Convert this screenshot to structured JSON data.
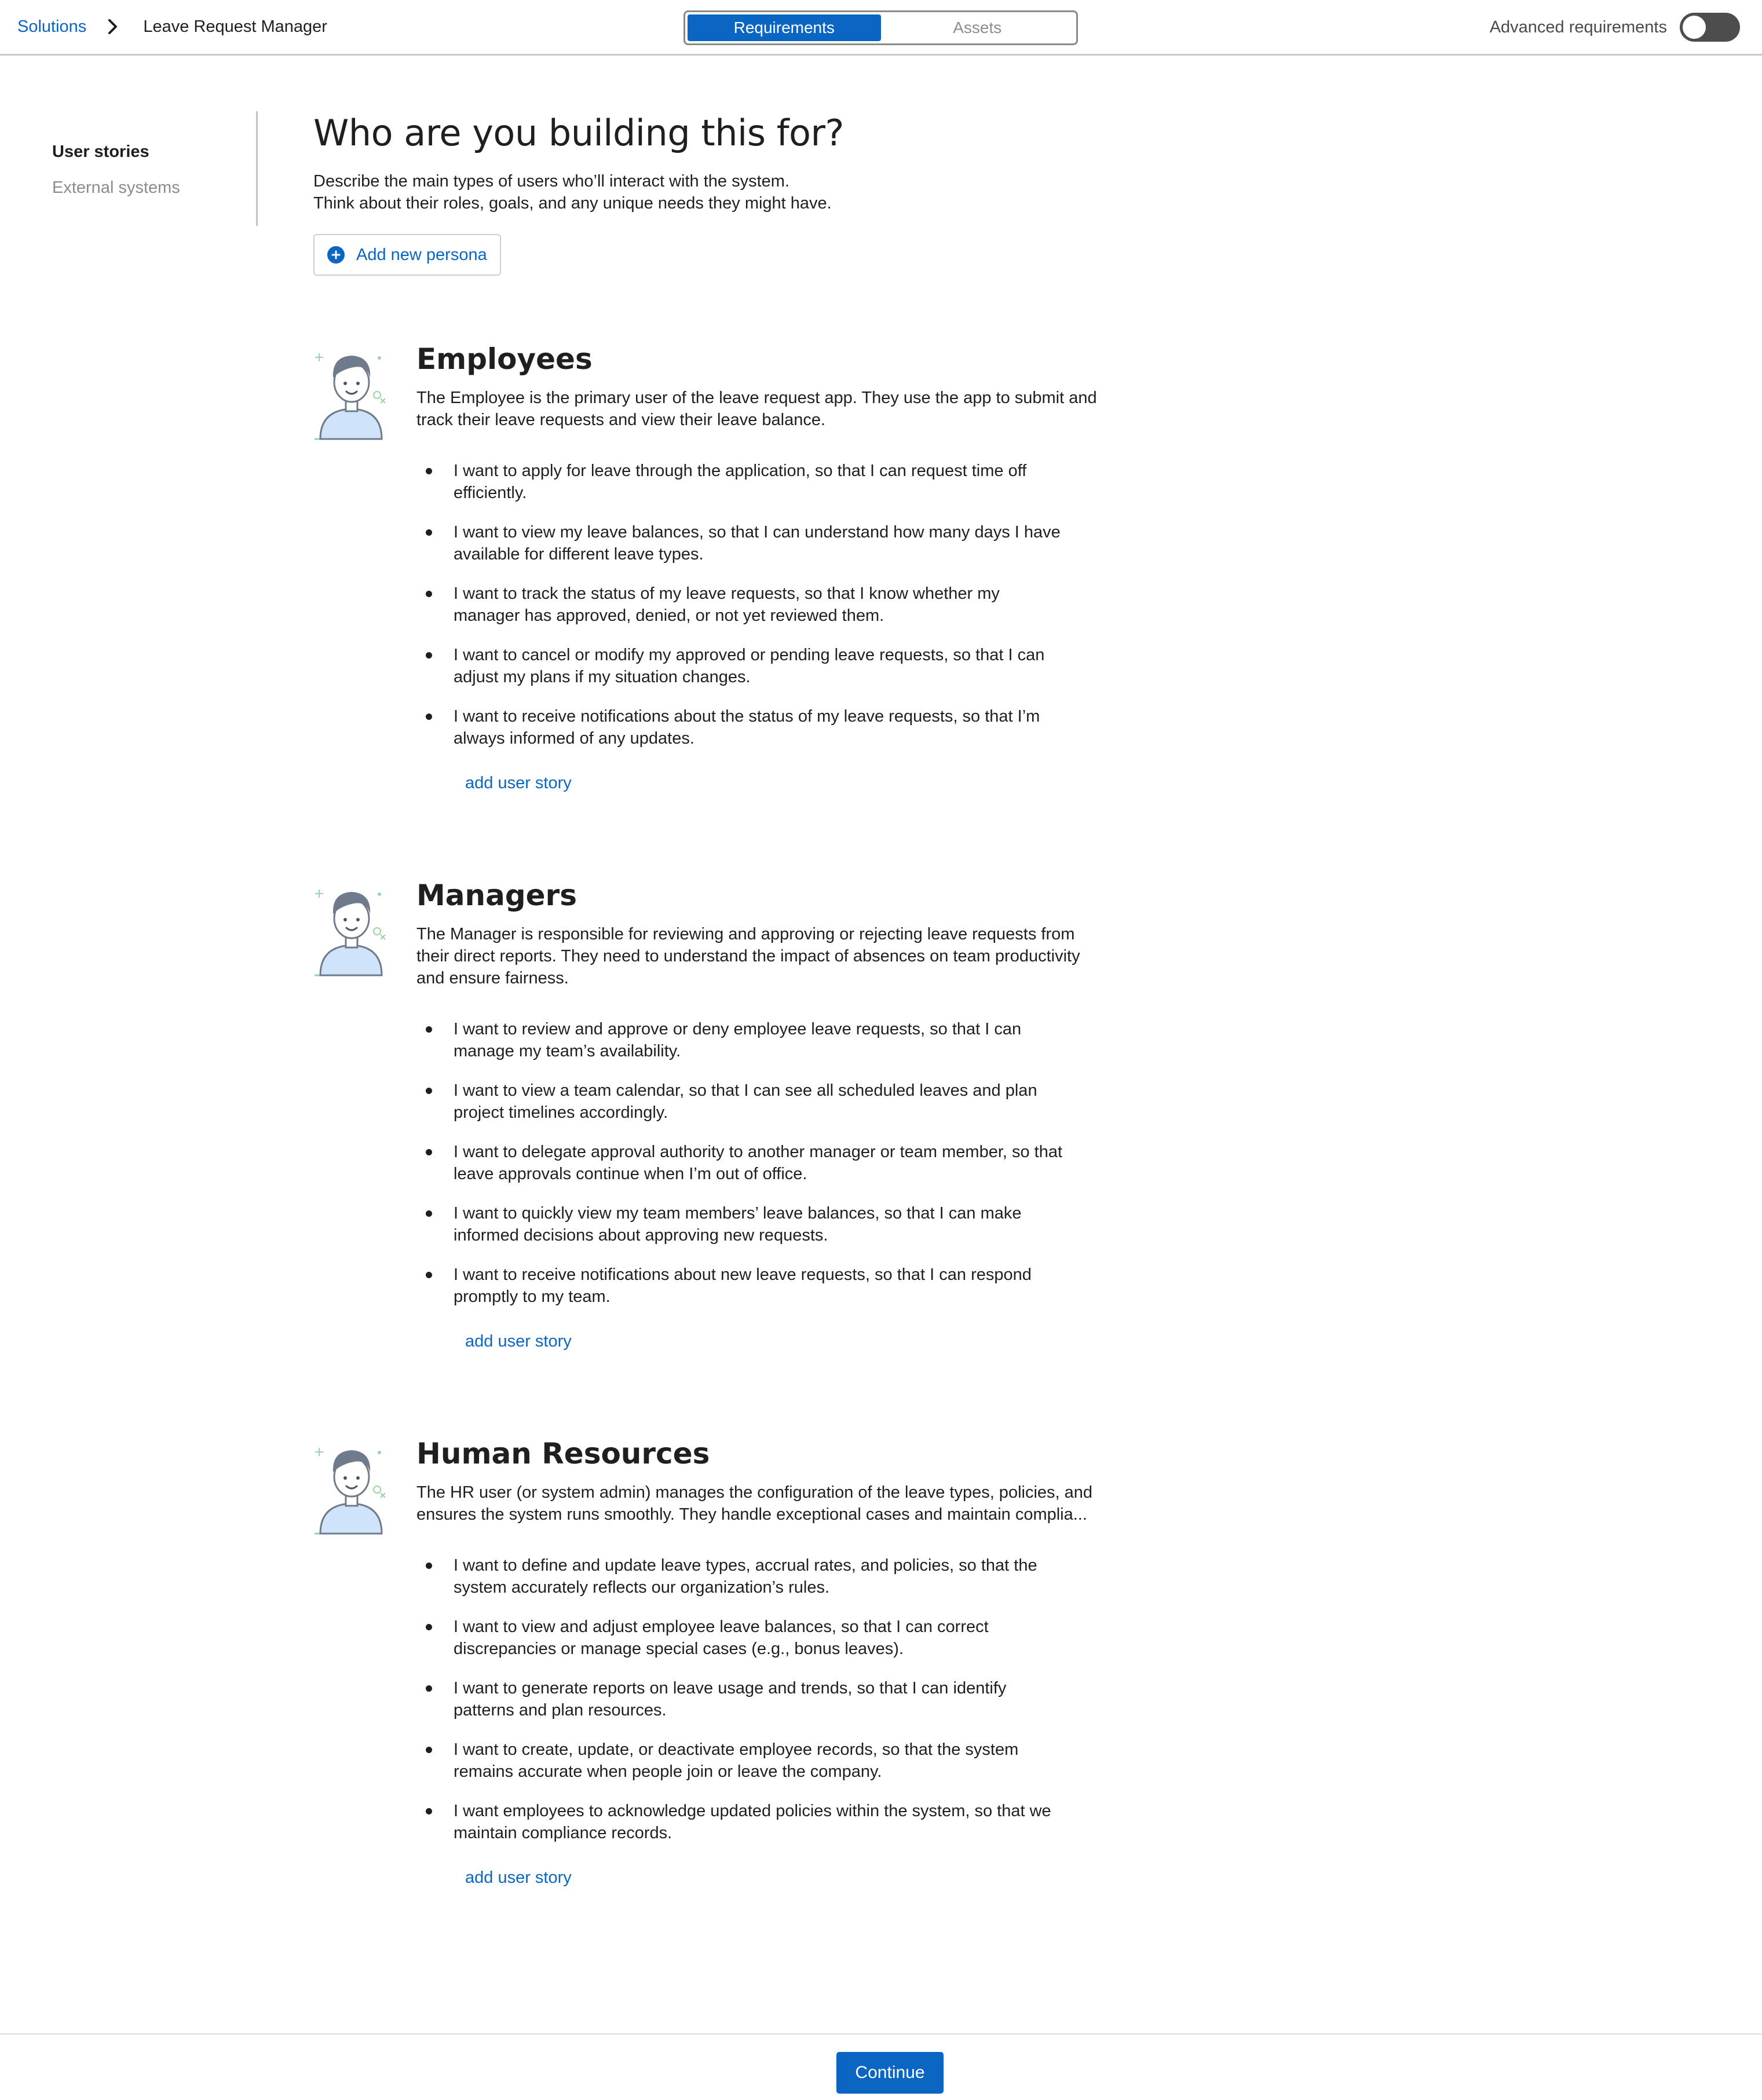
{
  "breadcrumb": {
    "root": "Solutions",
    "current": "Leave Request Manager"
  },
  "tabs": [
    {
      "label": "Requirements",
      "active": true
    },
    {
      "label": "Assets",
      "active": false
    }
  ],
  "advanced": {
    "label": "Advanced requirements",
    "enabled": false
  },
  "sidebar": {
    "items": [
      {
        "label": "User stories",
        "active": true
      },
      {
        "label": "External systems",
        "active": false
      }
    ]
  },
  "main": {
    "title": "Who are you building this for?",
    "desc_line1": "Describe the main types of users who’ll interact with the system.",
    "desc_line2": "Think about their roles, goals, and any unique needs they might have.",
    "add_persona_label": "Add new persona"
  },
  "personas": [
    {
      "name": "Employees",
      "description": "The Employee is the primary user of the leave request app. They use the app to submit and track their leave requests and view their leave balance.",
      "stories": [
        "I want to apply for leave through the application, so that I can request time off efficiently.",
        "I want to view my leave balances, so that I can understand how many days I have available for different leave types.",
        "I want to track the status of my leave requests, so that I know whether my manager has approved, denied, or not yet reviewed them.",
        "I want to cancel or modify my approved or pending leave requests, so that I can adjust my plans if my situation changes.",
        "I want to receive notifications about the status of my leave requests, so that I’m always informed of any updates."
      ],
      "add_story_label": "add user story"
    },
    {
      "name": "Managers",
      "description": "The Manager is responsible for reviewing and approving or rejecting leave requests from their direct reports. They need to understand the impact of absences on team productivity and ensure fairness.",
      "stories": [
        "I want to review and approve or deny employee leave requests, so that I can manage my team’s availability.",
        "I want to view a team calendar, so that I can see all scheduled leaves and plan project timelines accordingly.",
        "I want to delegate approval authority to another manager or team member, so that leave approvals continue when I’m out of office.",
        "I want to quickly view my team members’ leave balances, so that I can make informed decisions about approving new requests.",
        "I want to receive notifications about new leave requests, so that I can respond promptly to my team."
      ],
      "add_story_label": "add user story"
    },
    {
      "name": "Human Resources",
      "description": "The HR user (or system admin) manages the configuration of the leave types, policies, and ensures the system runs smoothly. They handle exceptional cases and maintain complia...",
      "stories": [
        "I want to define and update leave types, accrual rates, and policies, so that the system accurately reflects our organization’s rules.",
        "I want to view and adjust employee leave balances, so that I can correct discrepancies or manage special cases (e.g., bonus leaves).",
        "I want to generate reports on leave usage and trends, so that I can identify patterns and plan resources.",
        "I want to create, update, or deactivate employee records, so that the system remains accurate when people join or leave the company.",
        "I want employees to acknowledge updated policies within the system, so that we maintain compliance records."
      ],
      "add_story_label": "add user story"
    }
  ],
  "footer": {
    "continue_label": "Continue"
  },
  "colors": {
    "accent": "#0a66c2",
    "toggle_off": "#4d4d4d",
    "muted_text": "#8c8c8c"
  },
  "icons": {
    "breadcrumb_separator": "chevron-right-icon",
    "add_persona": "plus-circle-icon",
    "persona_avatar": "user-avatar-icon"
  }
}
